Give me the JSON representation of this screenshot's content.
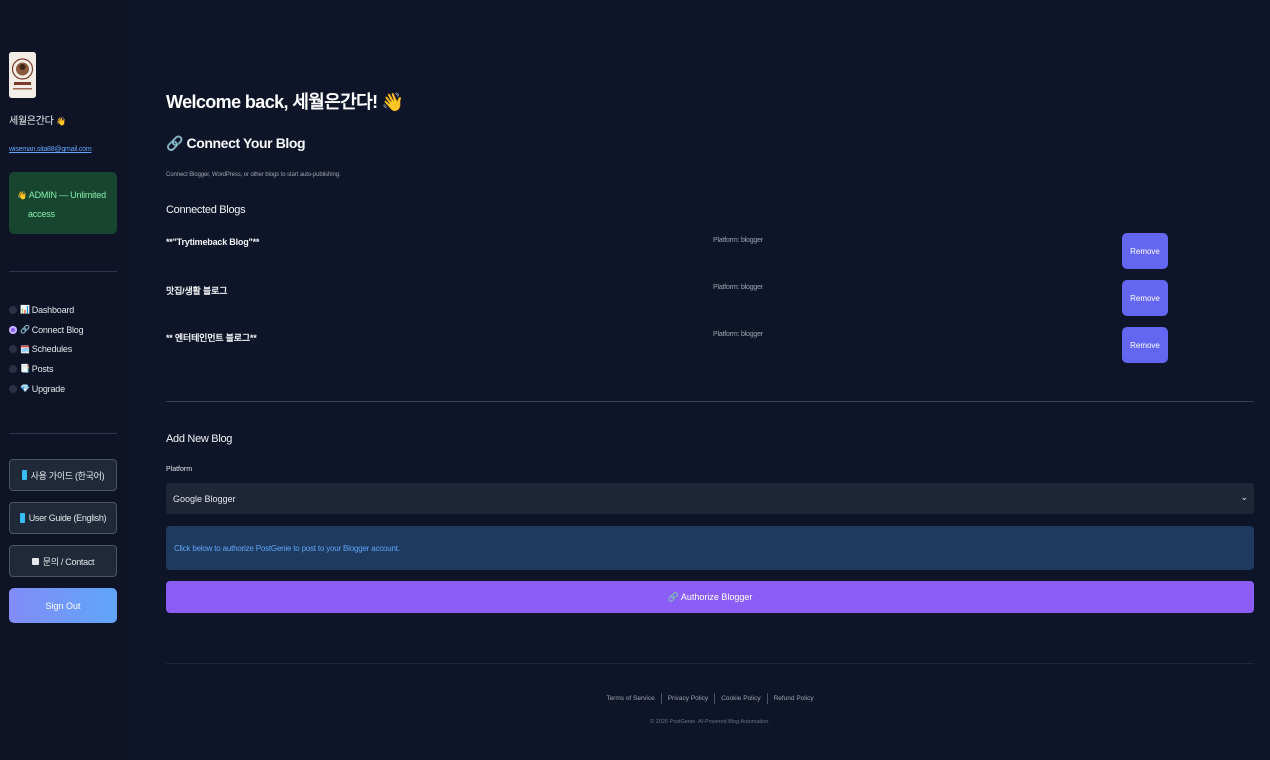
{
  "sidebar": {
    "username": "세월은간다",
    "username_emoji": "👋",
    "email": "wiseman.sita88@gmail.com",
    "admin": {
      "icon": "👋",
      "line1": "ADMIN — Unlimited",
      "line2": "access"
    },
    "nav": [
      {
        "emoji": "📊",
        "label": "Dashboard",
        "active": false
      },
      {
        "emoji": "🔗",
        "label": "Connect Blog",
        "active": true
      },
      {
        "emoji": "🗓️",
        "label": "Schedules",
        "active": false
      },
      {
        "emoji": "📑",
        "label": "Posts",
        "active": false
      },
      {
        "emoji": "💎",
        "label": "Upgrade",
        "active": false
      }
    ],
    "guide_ko": "사용 가이드 (한국어)",
    "guide_en": "User Guide (English)",
    "contact": "문의 / Contact",
    "signout": "Sign Out"
  },
  "main": {
    "welcome": "Welcome back, 세월은간다! 👋",
    "connect_title": "🔗 Connect Your Blog",
    "connect_subtitle": "Connect Blogger, WordPress, or other blogs to start auto-publishing.",
    "connected_title": "Connected Blogs",
    "blogs": [
      {
        "name": "**\"Trytimeback Blog\"**",
        "platform": "Platform: blogger",
        "remove": "Remove"
      },
      {
        "name": "맛집/생활 블로그",
        "platform": "Platform: blogger",
        "remove": "Remove"
      },
      {
        "name": "** 엔터테인먼트 블로그**",
        "platform": "Platform: blogger",
        "remove": "Remove"
      }
    ],
    "add_title": "Add New Blog",
    "platform_label": "Platform",
    "platform_value": "Google Blogger",
    "info_text": "Click below to authorize PostGenie to post to your Blogger account.",
    "authorize": "🔗 Authorize Blogger"
  },
  "footer": {
    "links": [
      "Terms of Service",
      "Privacy Policy",
      "Cookie Policy",
      "Refund Policy"
    ],
    "copyright": "© 2026 PostGenie. AI-Powered Blog Automation."
  },
  "colors": {
    "background": "#0f1528",
    "accent": "#8b5cf6",
    "remove": "#6366f1",
    "admin_bg": "#17452f",
    "link": "#60a5fa"
  }
}
